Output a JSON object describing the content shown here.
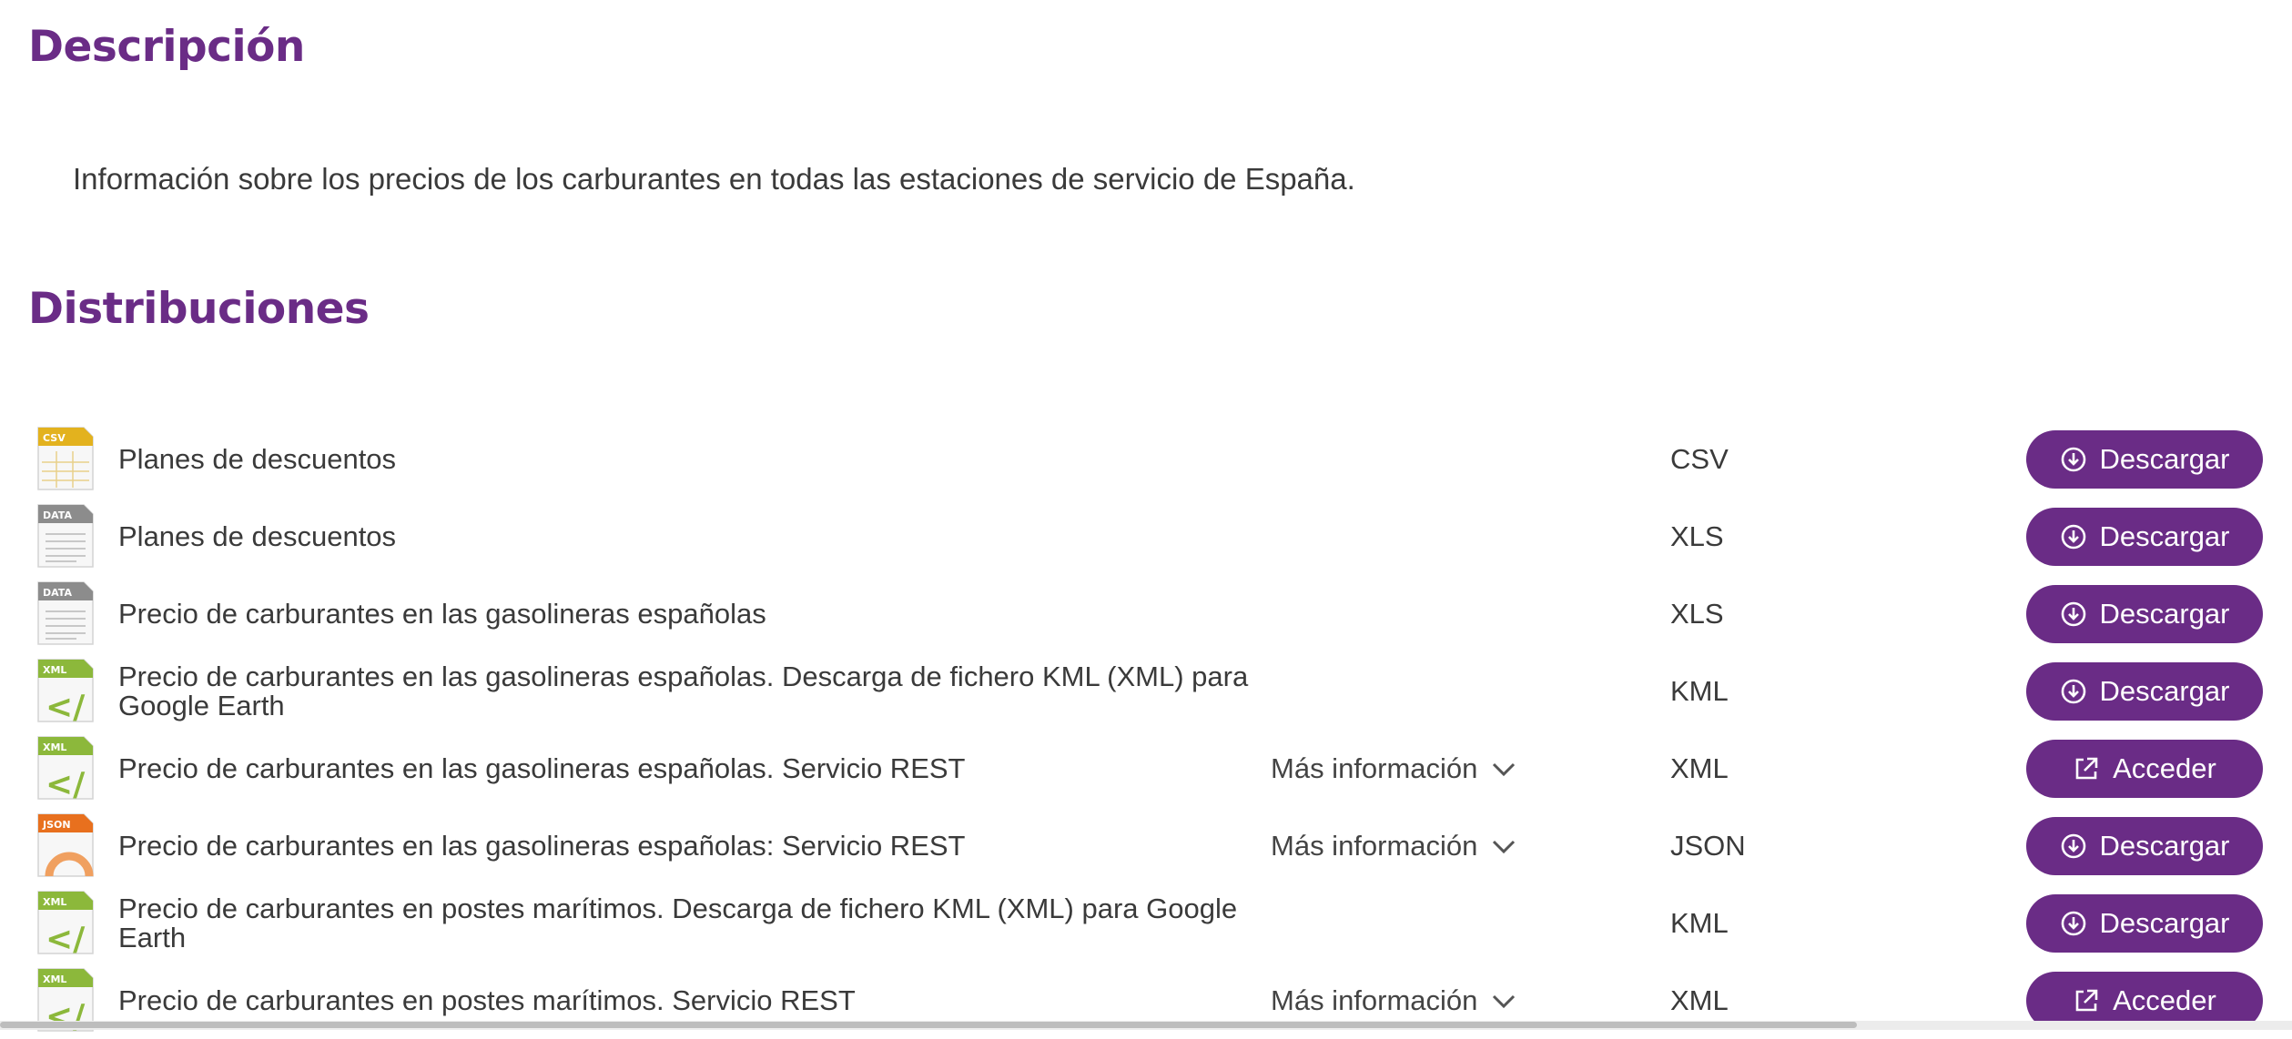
{
  "description": {
    "title": "Descripción",
    "text": "Información sobre los precios de los carburantes en todas las estaciones de servicio de España."
  },
  "distributions": {
    "title": "Distribuciones",
    "items": [
      {
        "icon": "csv-file-icon",
        "icon_label": "CSV",
        "title": "Planes de descuentos",
        "more": "",
        "format": "CSV",
        "action": "Descargar",
        "action_type": "download"
      },
      {
        "icon": "data-file-icon",
        "icon_label": "DATA",
        "title": "Planes de descuentos",
        "more": "",
        "format": "XLS",
        "action": "Descargar",
        "action_type": "download"
      },
      {
        "icon": "data-file-icon",
        "icon_label": "DATA",
        "title": "Precio de carburantes en las gasolineras españolas",
        "more": "",
        "format": "XLS",
        "action": "Descargar",
        "action_type": "download"
      },
      {
        "icon": "xml-file-icon",
        "icon_label": "XML",
        "title": "Precio de carburantes en las gasolineras españolas. Descarga de fichero KML (XML) para Google Earth",
        "more": "",
        "format": "KML",
        "action": "Descargar",
        "action_type": "download"
      },
      {
        "icon": "xml-file-icon",
        "icon_label": "XML",
        "title": "Precio de carburantes en las gasolineras españolas. Servicio REST",
        "more": "Más información",
        "format": "XML",
        "action": "Acceder",
        "action_type": "external"
      },
      {
        "icon": "json-file-icon",
        "icon_label": "JSON",
        "title": "Precio de carburantes en las gasolineras españolas: Servicio REST",
        "more": "Más información",
        "format": "JSON",
        "action": "Descargar",
        "action_type": "download"
      },
      {
        "icon": "xml-file-icon",
        "icon_label": "XML",
        "title": "Precio de carburantes en postes marítimos. Descarga de fichero KML (XML) para Google Earth",
        "more": "",
        "format": "KML",
        "action": "Descargar",
        "action_type": "download"
      },
      {
        "icon": "xml-file-icon",
        "icon_label": "XML",
        "title": "Precio de carburantes en postes marítimos. Servicio REST",
        "more": "Más información",
        "format": "XML",
        "action": "Acceder",
        "action_type": "external"
      }
    ]
  },
  "colors": {
    "accent": "#6a2c86",
    "text": "#3a3a3a",
    "csv_icon": "#e3b21e",
    "data_icon": "#8c8c8c",
    "xml_icon": "#8cb83b",
    "json_icon": "#e8701e"
  }
}
